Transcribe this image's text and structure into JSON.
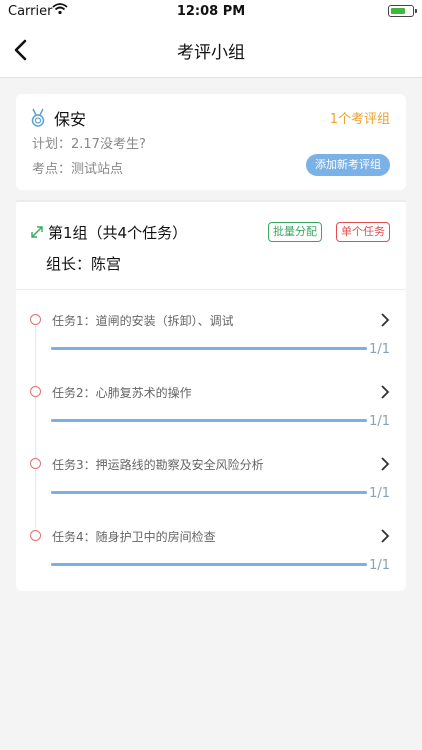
{
  "status_bar": {
    "carrier": "Carrier",
    "time": "12:08 PM"
  },
  "nav": {
    "title": "考评小组"
  },
  "exam": {
    "name": "保安",
    "group_count": "1个考评组",
    "plan": "计划：2.17没考生?",
    "site": "考点：测试站点",
    "add_group_label": "添加新考评组"
  },
  "group": {
    "title": "第1组（共4个任务）",
    "batch_label": "批量分配",
    "single_label": "单个任务",
    "leader": "组长：陈宫"
  },
  "tasks": [
    {
      "label": "任务1：道闸的安装（拆卸）、调试",
      "progress": "1/1",
      "fraction": 1.0
    },
    {
      "label": "任务2：心肺复苏术的操作",
      "progress": "1/1",
      "fraction": 1.0
    },
    {
      "label": "任务3：押运路线的勘察及安全风险分析",
      "progress": "1/1",
      "fraction": 1.0
    },
    {
      "label": "任务4：随身护卫中的房间检查",
      "progress": "1/1",
      "fraction": 1.0
    }
  ],
  "colors": {
    "accent_blue": "#7ab1e6",
    "orange": "#f0a030",
    "green": "#3aa860",
    "red": "#e05050"
  },
  "icons": {
    "back": "chevron-left-icon",
    "medal": "medal-icon",
    "expand": "expand-arrows-icon",
    "task_chevron": "chevron-right-icon"
  }
}
